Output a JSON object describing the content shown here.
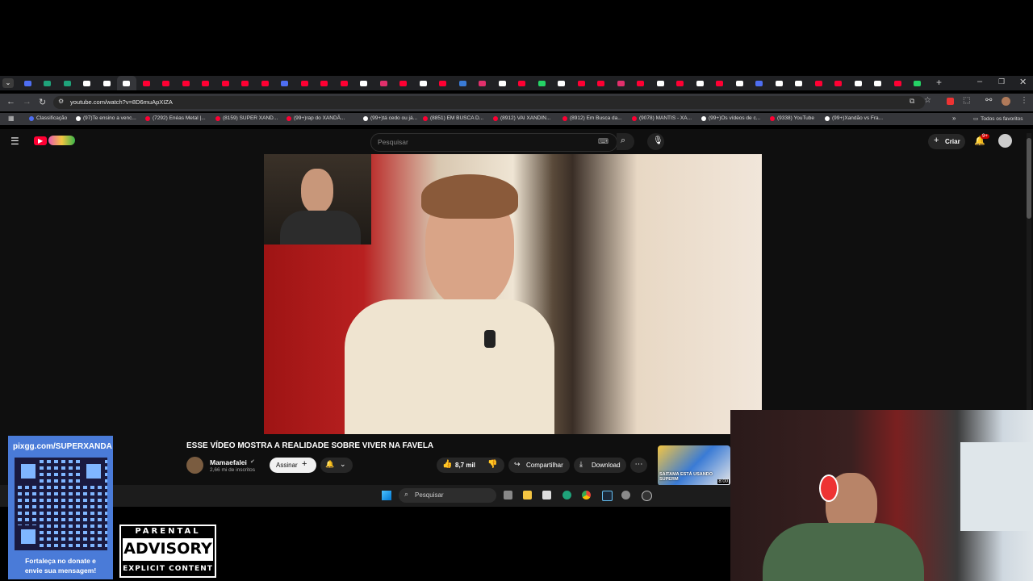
{
  "browser": {
    "url": "youtube.com/watch?v=8D6muApXIZA",
    "bookmarks": [
      {
        "label": "Classificação",
        "color": "#4e6ef2"
      },
      {
        "label": "(97)Te ensino a venc...",
        "color": "#ffffff"
      },
      {
        "label": "(7292) Enéas Metal |...",
        "color": "#ff0033"
      },
      {
        "label": "(8159) SUPER XAND...",
        "color": "#ff0033"
      },
      {
        "label": "(99+)rap do XANDÃ...",
        "color": "#ff0033"
      },
      {
        "label": "(99+)tá cedo ou já...",
        "color": "#ffffff"
      },
      {
        "label": "(8851) EM BUSCA D...",
        "color": "#ff0033"
      },
      {
        "label": "(8912) VAI XANDIN...",
        "color": "#ff0033"
      },
      {
        "label": "(8912) Em Busca da...",
        "color": "#ff0033"
      },
      {
        "label": "(9078) MANTIS - XA...",
        "color": "#ff0033"
      },
      {
        "label": "(99+)Os vídeos de c...",
        "color": "#ffffff"
      },
      {
        "label": "(9338) YouTube",
        "color": "#ff0033"
      },
      {
        "label": "(99+)Xandão vs Fra...",
        "color": "#ffffff"
      }
    ],
    "all_bookmarks": "Todos os favoritos"
  },
  "youtube": {
    "search_placeholder": "Pesquisar",
    "create_label": "Criar",
    "notif_count": "9+",
    "video_title": "ESSE VÍDEO MOSTRA A REALIDADE SOBRE VIVER NA FAVELA",
    "channel_name": "Mamaefalei",
    "subscribers": "2,66 mi de inscritos",
    "subscribe_label": "Assinar",
    "likes": "8,7 mil",
    "share_label": "Compartilhar",
    "download_label": "Download",
    "thumb_text": "SAITAMA ESTÁ USANDO SUPERM",
    "thumb_duration": "8:00"
  },
  "taskbar": {
    "search_label": "Pesquisar"
  },
  "overlay": {
    "donate_url": "pixgg.com/SUPERXANDA",
    "donate_text1": "Fortaleça no donate e",
    "donate_text2": "envie sua mensagem!",
    "advisory_top": "PARENTAL",
    "advisory_mid": "ADVISORY",
    "advisory_bottom": "EXPLICIT CONTENT"
  },
  "colors": {
    "yt_red": "#ff0033",
    "tab_bg": "#202124",
    "toolbar_bg": "#35363a",
    "qr_bg": "#7fb6ff"
  }
}
